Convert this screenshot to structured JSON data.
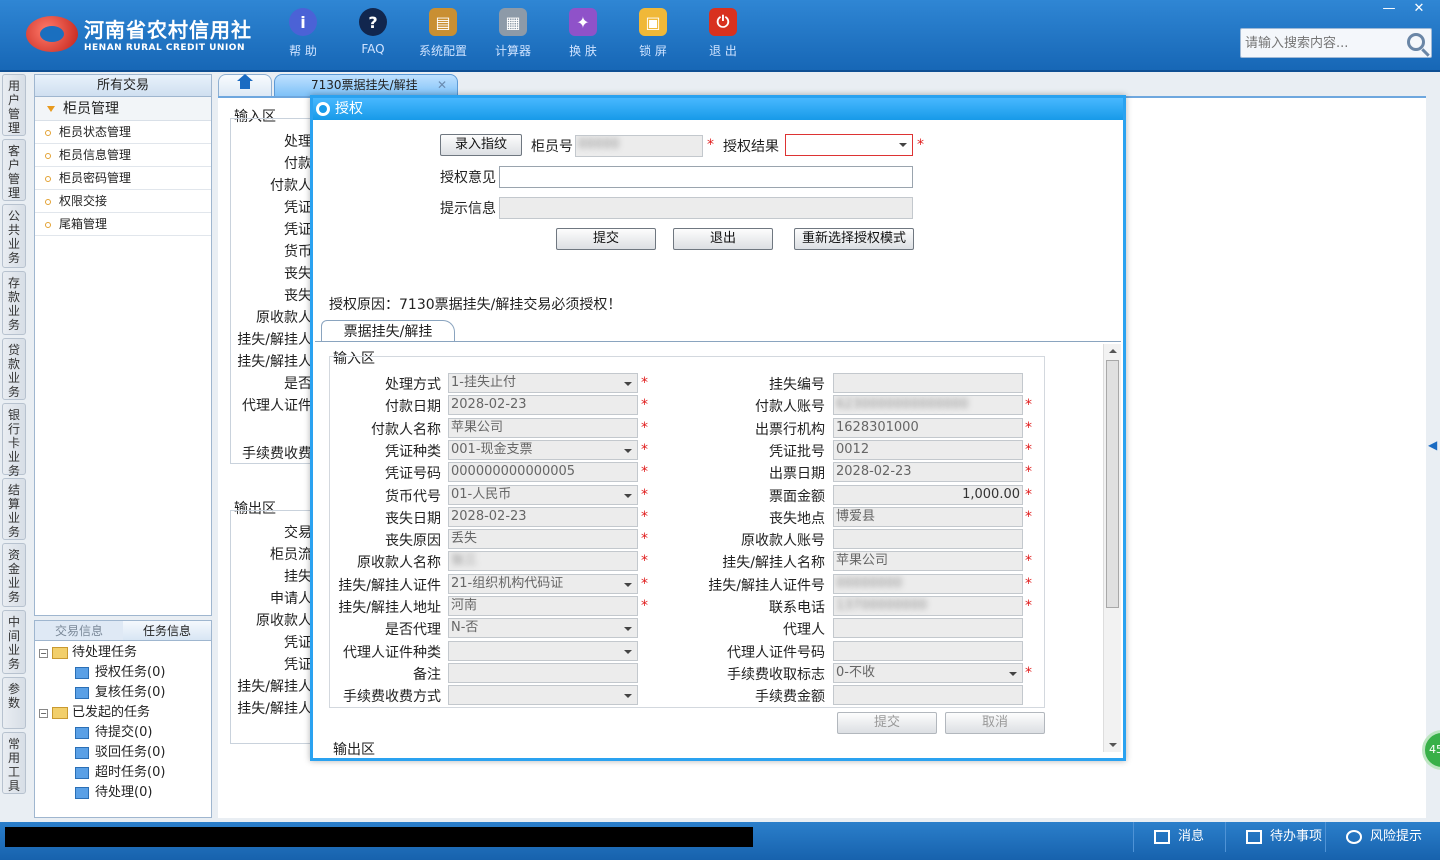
{
  "brand": {
    "name_cn": "河南省农村信用社",
    "name_en": "HENAN RURAL CREDIT UNION",
    "color": "#1767b6"
  },
  "toolbar": [
    {
      "label": "帮 助",
      "icon": "info-icon",
      "glyph": "i"
    },
    {
      "label": "FAQ",
      "icon": "question-icon",
      "glyph": "?"
    },
    {
      "label": "系统配置",
      "icon": "toolbox-icon",
      "glyph": "▤"
    },
    {
      "label": "计算器",
      "icon": "calculator-icon",
      "glyph": "▦"
    },
    {
      "label": "换 肤",
      "icon": "shirt-icon",
      "glyph": "✦"
    },
    {
      "label": "锁 屏",
      "icon": "lock-icon",
      "glyph": "▣"
    },
    {
      "label": "退 出",
      "icon": "power-icon",
      "glyph": "⏻"
    }
  ],
  "window": {
    "minimize": "—",
    "close": "✕"
  },
  "search": {
    "placeholder": "请输入搜索内容..."
  },
  "vtabs": [
    "用户管理",
    "客户管理",
    "公共业务",
    "存款业务",
    "贷款业务",
    "银行卡业务",
    "结算业务",
    "资金业务",
    "中间业务",
    "参数",
    "常用工具"
  ],
  "sidebar": {
    "header": "所有交易",
    "group": "柜员管理",
    "items": [
      "柜员状态管理",
      "柜员信息管理",
      "柜员密码管理",
      "权限交接",
      "尾箱管理"
    ]
  },
  "tasks": {
    "tab1": "交易信息",
    "tab2": "任务信息",
    "pending": "待处理任务",
    "auth": "授权任务(0)",
    "review": "复核任务(0)",
    "initiated": "已发起的任务",
    "to_submit": "待提交(0)",
    "rejected": "驳回任务(0)",
    "timeout": "超时任务(0)",
    "processing": "待处理(0)"
  },
  "main_tab": {
    "label": "7130票据挂失/解挂",
    "close": "✕"
  },
  "background": {
    "input_area": "输入区",
    "output_area": "输出区",
    "labels_in": [
      "处理",
      "付款",
      "付款人",
      "凭证",
      "凭证",
      "货币",
      "丧失",
      "丧失",
      "原收款人",
      "挂失/解挂人",
      "挂失/解挂人",
      "是否",
      "代理人证件",
      "手续费收费"
    ],
    "labels_out": [
      "交易",
      "柜员流",
      "挂失",
      "申请人",
      "原收款人",
      "凭证",
      "凭证",
      "挂失/解挂人",
      "挂失/解挂人"
    ]
  },
  "modal": {
    "title": "授权",
    "fingerprint_button": "录入指纹",
    "teller_no_label": "柜员号",
    "teller_no": "00000",
    "auth_result_label": "授权结果",
    "auth_result": "",
    "opinion_label": "授权意见",
    "opinion": "",
    "hint_label": "提示信息",
    "hint": "",
    "submit": "提交",
    "exit": "退出",
    "reselect": "重新选择授权模式",
    "reason": "授权原因：7130票据挂失/解挂交易必须授权！",
    "subtab": "票据挂失/解挂",
    "input_area": "输入区",
    "output_area": "输出区",
    "form_submit": "提交",
    "form_cancel": "取消",
    "star": "*"
  },
  "form": {
    "left": [
      {
        "label": "处理方式",
        "value": "1-挂失止付",
        "dropdown": true,
        "required": true
      },
      {
        "label": "付款日期",
        "value": "2028-02-23",
        "required": true
      },
      {
        "label": "付款人名称",
        "value": "苹果公司",
        "required": true
      },
      {
        "label": "凭证种类",
        "value": "001-现金支票",
        "dropdown": true,
        "required": true
      },
      {
        "label": "凭证号码",
        "value": "000000000000005",
        "required": true
      },
      {
        "label": "货币代号",
        "value": "01-人民币",
        "dropdown": true,
        "required": true
      },
      {
        "label": "丧失日期",
        "value": "2028-02-23",
        "required": true
      },
      {
        "label": "丧失原因",
        "value": "丢失",
        "required": true
      },
      {
        "label": "原收款人名称",
        "value": "张三",
        "blur": true,
        "required": true
      },
      {
        "label": "挂失/解挂人证件",
        "value": "21-组织机构代码证",
        "dropdown": true,
        "required": true
      },
      {
        "label": "挂失/解挂人地址",
        "value": "河南",
        "required": true
      },
      {
        "label": "是否代理",
        "value": "N-否",
        "dropdown": true
      },
      {
        "label": "代理人证件种类",
        "value": "",
        "dropdown": true
      },
      {
        "label": "备注",
        "value": ""
      },
      {
        "label": "手续费收费方式",
        "value": "",
        "dropdown": true
      }
    ],
    "right": [
      {
        "label": "挂失编号",
        "value": ""
      },
      {
        "label": "付款人账号",
        "value": "6230000000000000",
        "blur": true,
        "required": true
      },
      {
        "label": "出票行机构",
        "value": "1628301000",
        "required": true
      },
      {
        "label": "凭证批号",
        "value": "0012",
        "required": true
      },
      {
        "label": "出票日期",
        "value": "2028-02-23",
        "required": true
      },
      {
        "label": "票面金额",
        "value": "1,000.00",
        "align": "right",
        "required": true
      },
      {
        "label": "丧失地点",
        "value": "博爱县",
        "required": true
      },
      {
        "label": "原收款人账号",
        "value": ""
      },
      {
        "label": "挂失/解挂人名称",
        "value": "苹果公司",
        "required": true
      },
      {
        "label": "挂失/解挂人证件号",
        "value": "00000000",
        "blur": true,
        "required": true
      },
      {
        "label": "联系电话",
        "value": "13700000000",
        "blur": true,
        "required": true
      },
      {
        "label": "代理人",
        "value": ""
      },
      {
        "label": "代理人证件号码",
        "value": ""
      },
      {
        "label": "手续费收取标志",
        "value": "0-不收",
        "dropdown": true,
        "required": true
      },
      {
        "label": "手续费金额",
        "value": ""
      }
    ]
  },
  "status": {
    "message": "消息",
    "todo": "待办事项",
    "risk": "风险提示",
    "badge": "45"
  },
  "colors": {
    "accent": "#2aa2f0",
    "required": "#e01b1b",
    "status_bar": "#1762ad"
  }
}
